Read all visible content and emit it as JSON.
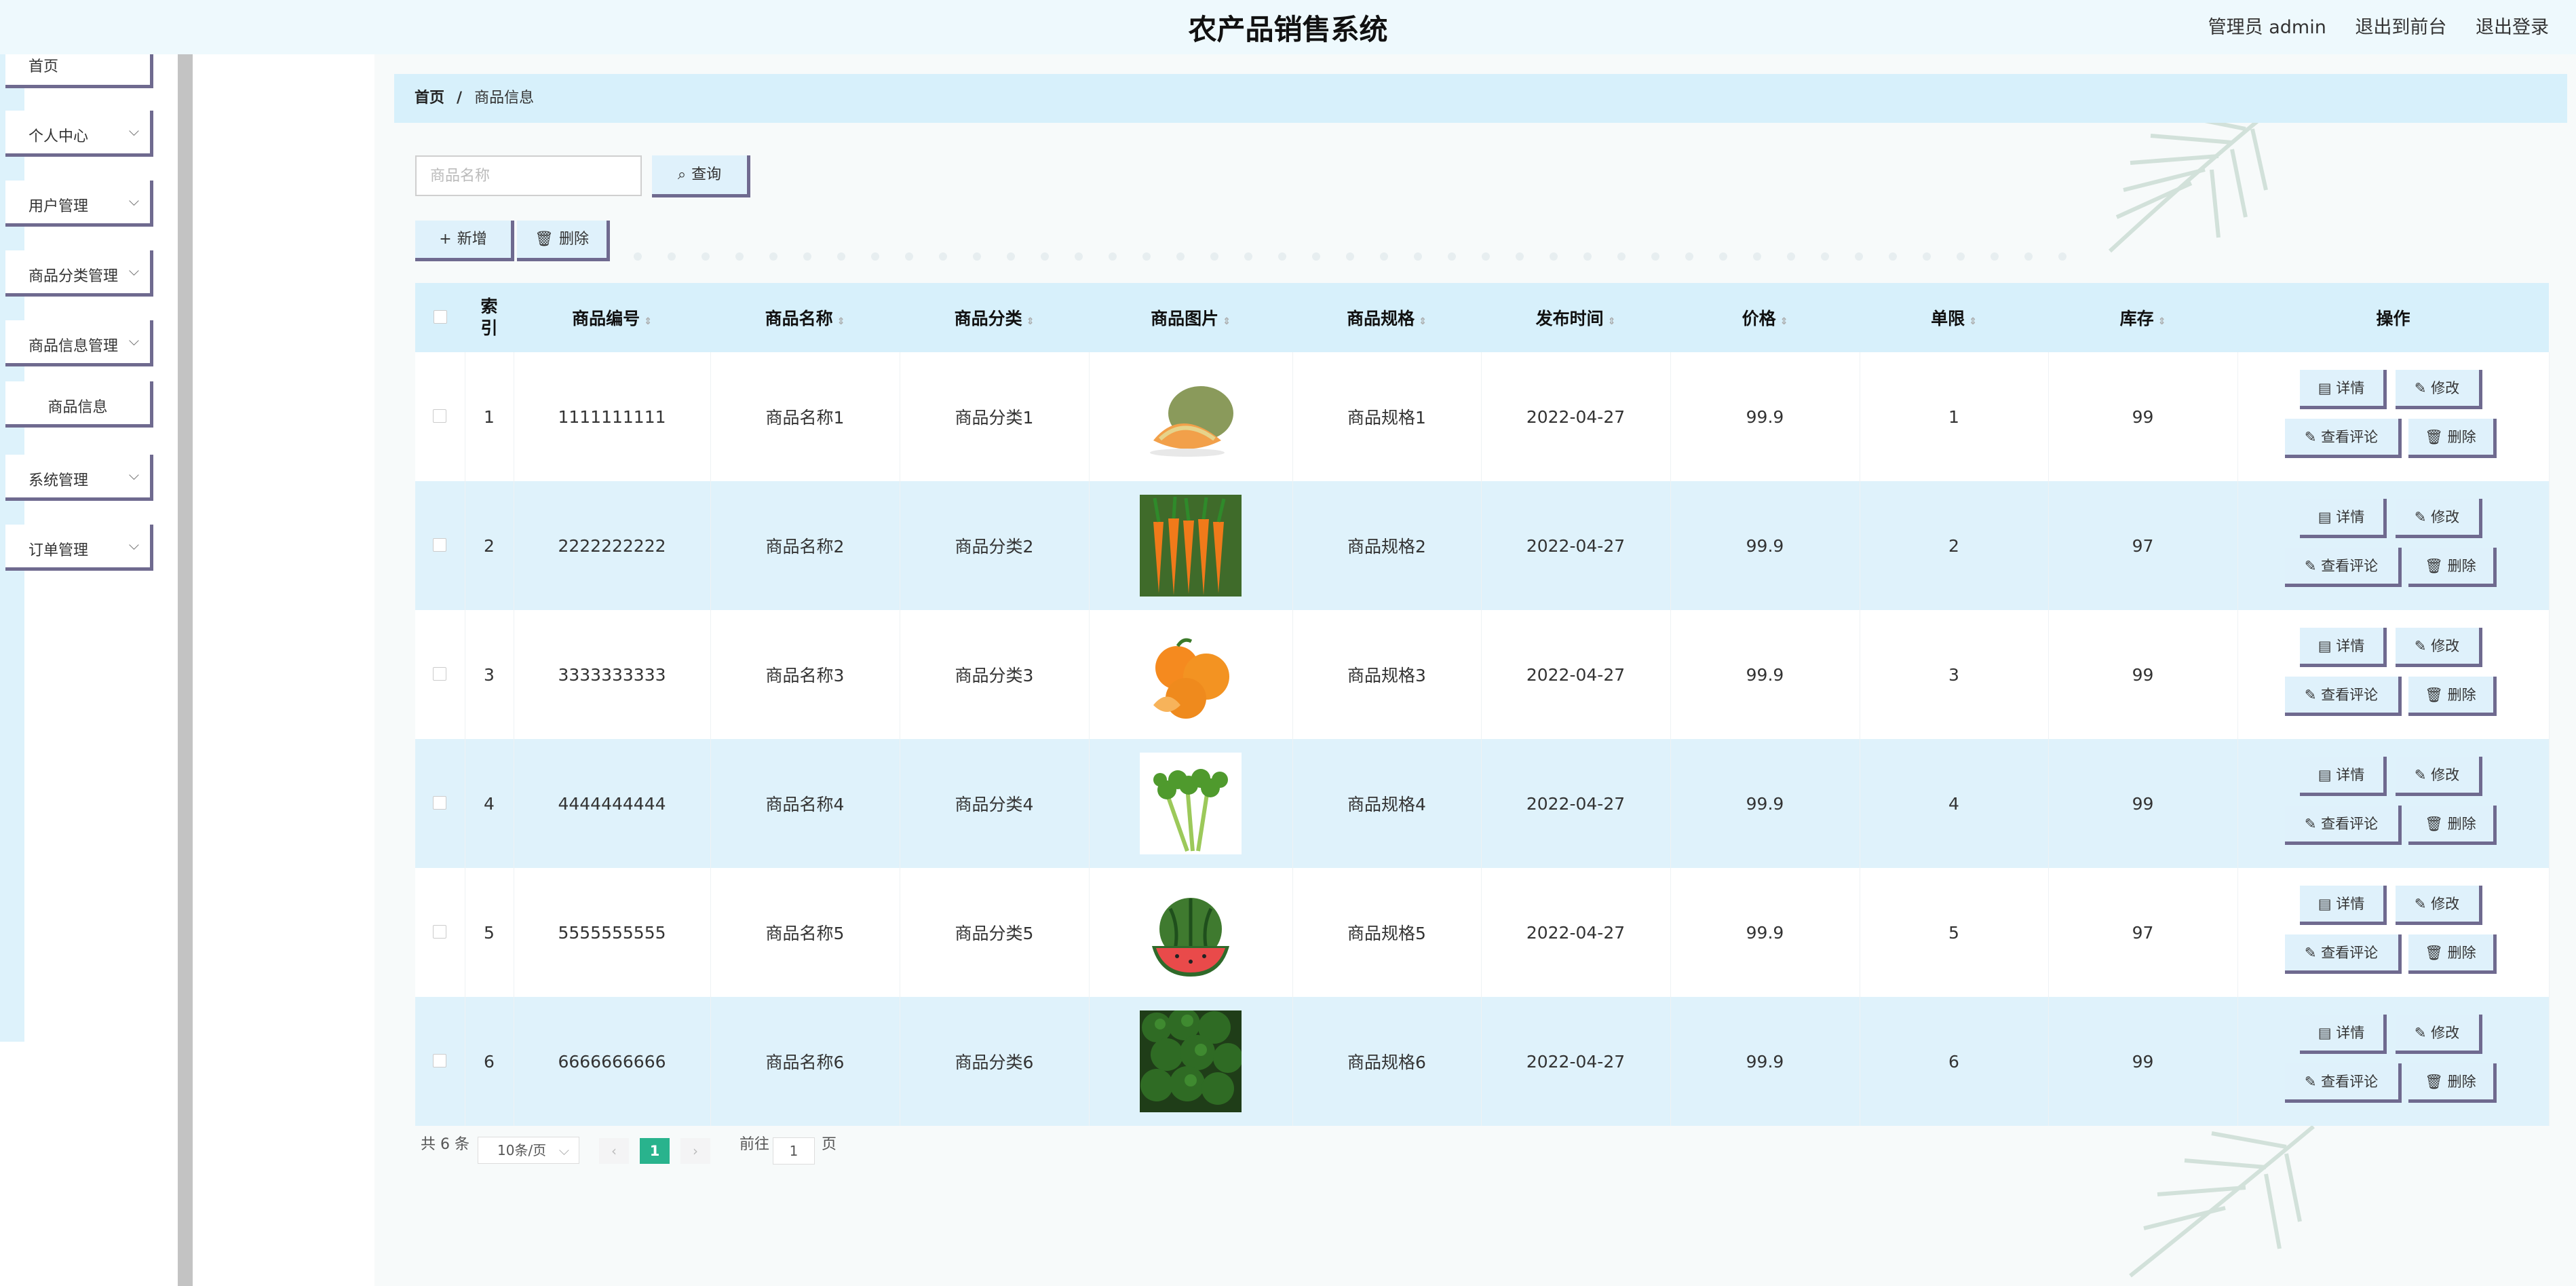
{
  "header": {
    "title": "农产品销售系统",
    "admin": "管理员 admin",
    "to_front": "退出到前台",
    "logout": "退出登录"
  },
  "sidebar": {
    "items": [
      {
        "label": "首页"
      },
      {
        "label": "个人中心",
        "expandable": true
      },
      {
        "label": "用户管理",
        "expandable": true
      },
      {
        "label": "商品分类管理",
        "expandable": true
      },
      {
        "label": "商品信息管理",
        "expandable": true
      },
      {
        "label": "商品信息",
        "sub": true
      },
      {
        "label": "系统管理",
        "expandable": true
      },
      {
        "label": "订单管理",
        "expandable": true
      }
    ]
  },
  "breadcrumb": {
    "home": "首页",
    "sep": "/",
    "current": "商品信息"
  },
  "search": {
    "placeholder": "商品名称",
    "button": "查询"
  },
  "actions": {
    "add": "新增",
    "delete": "删除"
  },
  "table": {
    "headers": [
      "索引",
      "商品编号",
      "商品名称",
      "商品分类",
      "商品图片",
      "商品规格",
      "发布时间",
      "价格",
      "单限",
      "库存",
      "操作"
    ],
    "rows": [
      {
        "index": "1",
        "code": "1111111111",
        "name": "商品名称1",
        "category": "商品分类1",
        "image": "melon",
        "spec": "商品规格1",
        "date": "2022-04-27",
        "price": "99.9",
        "limit": "1",
        "stock": "99"
      },
      {
        "index": "2",
        "code": "2222222222",
        "name": "商品名称2",
        "category": "商品分类2",
        "image": "carrot",
        "spec": "商品规格2",
        "date": "2022-04-27",
        "price": "99.9",
        "limit": "2",
        "stock": "97"
      },
      {
        "index": "3",
        "code": "3333333333",
        "name": "商品名称3",
        "category": "商品分类3",
        "image": "orange",
        "spec": "商品规格3",
        "date": "2022-04-27",
        "price": "99.9",
        "limit": "3",
        "stock": "99"
      },
      {
        "index": "4",
        "code": "4444444444",
        "name": "商品名称4",
        "category": "商品分类4",
        "image": "celery",
        "spec": "商品规格4",
        "date": "2022-04-27",
        "price": "99.9",
        "limit": "4",
        "stock": "99"
      },
      {
        "index": "5",
        "code": "5555555555",
        "name": "商品名称5",
        "category": "商品分类5",
        "image": "watermelon",
        "spec": "商品规格5",
        "date": "2022-04-27",
        "price": "99.9",
        "limit": "5",
        "stock": "97"
      },
      {
        "index": "6",
        "code": "6666666666",
        "name": "商品名称6",
        "category": "商品分类6",
        "image": "broccoli",
        "spec": "商品规格6",
        "date": "2022-04-27",
        "price": "99.9",
        "limit": "6",
        "stock": "99"
      }
    ],
    "row_buttons": {
      "detail": "详情",
      "edit": "修改",
      "review": "查看评论",
      "delete": "删除"
    }
  },
  "pagination": {
    "total": "共 6 条",
    "page_size": "10条/页",
    "current": "1",
    "goto_prefix": "前往",
    "goto_value": "1",
    "goto_suffix": "页"
  },
  "colors": {
    "header_bg": "#eef9fd",
    "accent_blue": "#d7f0fb",
    "button_border": "#6f6a8f",
    "pager_active": "#29b38d"
  }
}
